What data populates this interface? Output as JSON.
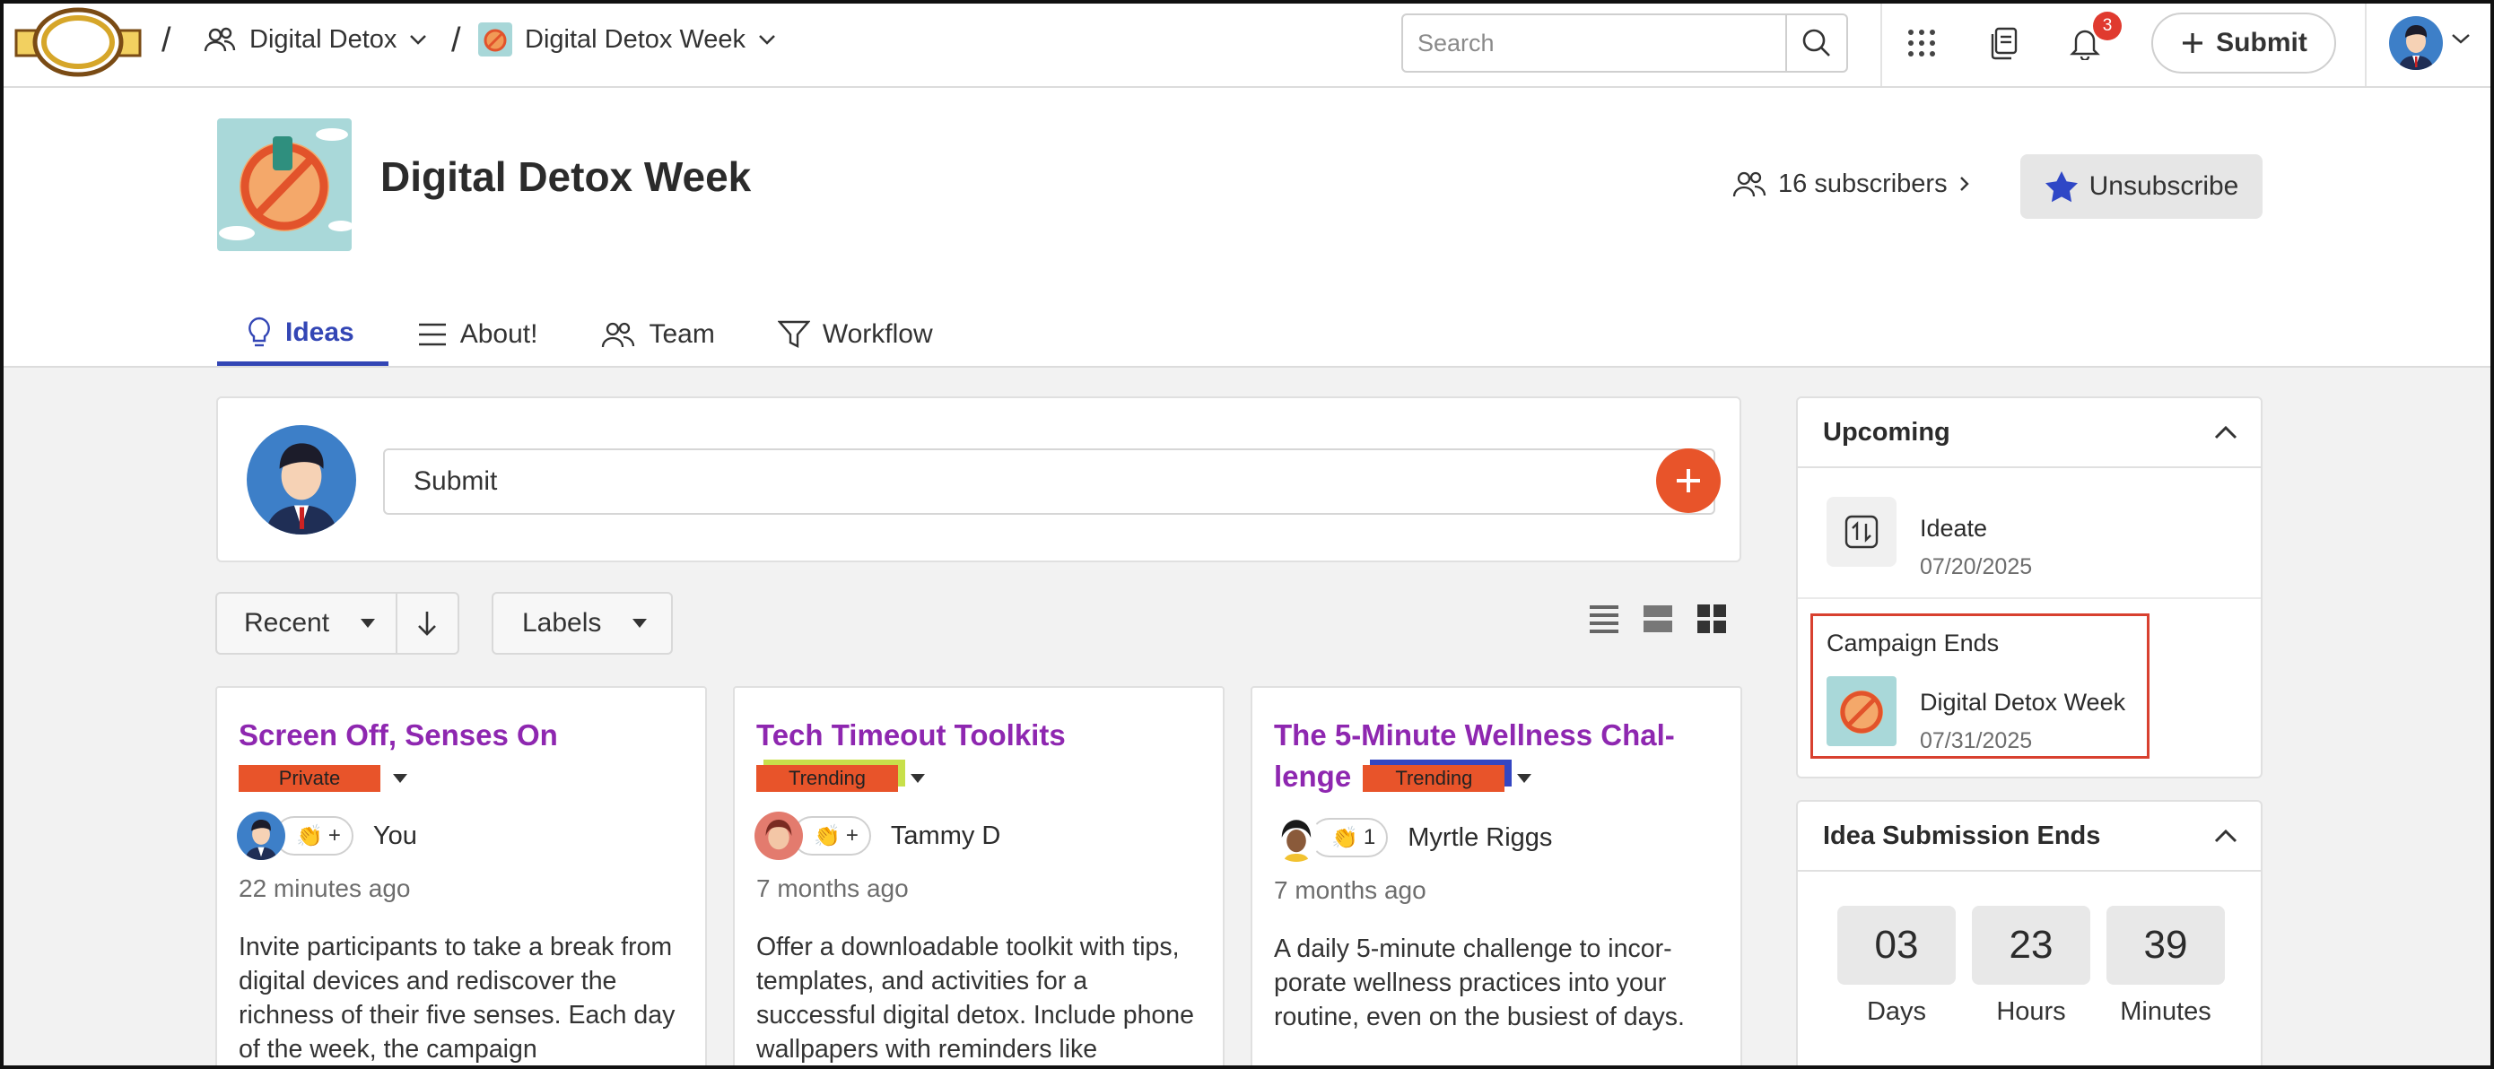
{
  "topbar": {
    "breadcrumb_sep": "/",
    "community": "Digital Detox",
    "campaign": "Digital Detox Week",
    "search_placeholder": "Search",
    "notification_count": "3",
    "submit_label": "Submit",
    "icons": [
      "logo",
      "group-icon",
      "search-icon",
      "apps-grid-icon",
      "pages-icon",
      "bell-icon",
      "plus-icon",
      "avatar",
      "chevron-down-icon"
    ]
  },
  "header": {
    "title": "Digital Detox Week",
    "subscribers": "16 subscribers",
    "unsubscribe_label": "Unsubscribe"
  },
  "tabs": [
    {
      "label": "Ideas",
      "icon": "lightbulb-icon",
      "active": true
    },
    {
      "label": "About!",
      "icon": "menu-lines-icon",
      "active": false
    },
    {
      "label": "Team",
      "icon": "team-icon",
      "active": false
    },
    {
      "label": "Workflow",
      "icon": "funnel-icon",
      "active": false
    }
  ],
  "composer": {
    "placeholder": "Submit"
  },
  "controls": {
    "sort_label": "Recent",
    "labels_label": "Labels"
  },
  "ideas": [
    {
      "title": "Screen Off, Senses On",
      "badge": "Private",
      "reaction_count": "+",
      "author": "You",
      "time": "22 minutes ago",
      "description": "Invite participants to take a break from digital devices and rediscover the richness of their five senses. Each day of the week, the campaign"
    },
    {
      "title": "Tech Timeout Toolkits",
      "badge": "Trending",
      "reaction_count": "+",
      "author": "Tammy D",
      "time": "7 months ago",
      "description": "Offer a downloadable toolkit with tips, templates, and activities for a successful digital detox. Include phone wallpapers with reminders like"
    },
    {
      "title_line1": "The 5-Minute Wellness Chal-",
      "title_line2": "lenge",
      "badge": "Trending",
      "reaction_count": "1",
      "author": "Myrtle Riggs",
      "time": "7 months ago",
      "description": "A daily 5-minute challenge to incor-porate wellness practices into your routine, even on the busiest of days."
    }
  ],
  "upcoming": {
    "title": "Upcoming",
    "events": [
      {
        "name": "Ideate",
        "date": "07/20/2025"
      },
      {
        "heading": "Campaign Ends",
        "name": "Digital Detox Week",
        "date": "07/31/2025"
      }
    ]
  },
  "submission": {
    "title": "Idea Submission Ends",
    "days": "03",
    "days_label": "Days",
    "hours": "23",
    "hours_label": "Hours",
    "minutes": "39",
    "minutes_label": "Minutes"
  },
  "colors": {
    "accent": "#3346b5",
    "brand_orange": "#e8542a",
    "idea_title": "#8e27b0",
    "highlight": "#d8402f"
  }
}
